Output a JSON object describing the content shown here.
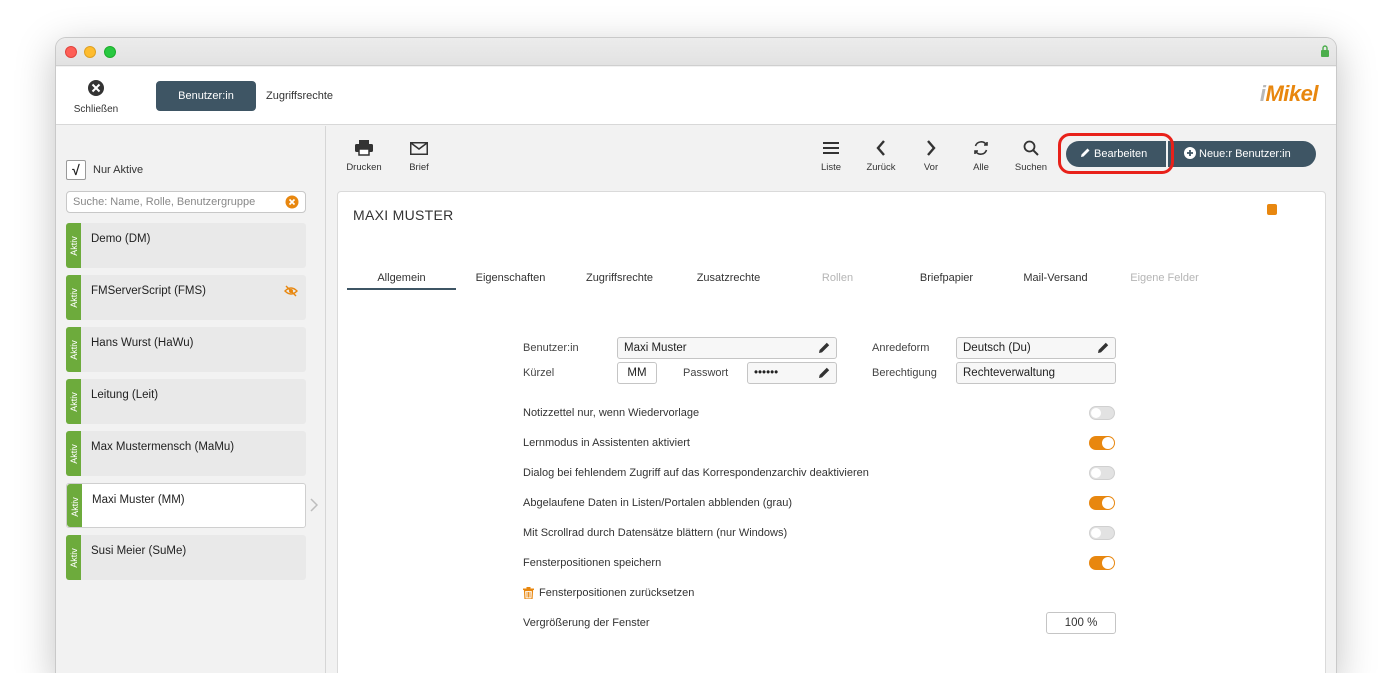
{
  "header": {
    "close_label": "Schließen",
    "tab_active": "Benutzer:in",
    "tab_rights": "Zugriffsrechte",
    "logo_i": "i",
    "logo_rest": "Mikel"
  },
  "sidebar": {
    "only_active_label": "Nur Aktive",
    "only_active_checked": true,
    "search_placeholder": "Suche: Name, Rolle, Benutzergruppe",
    "items": [
      {
        "status": "Aktiv",
        "name": "Demo (DM)"
      },
      {
        "status": "Aktiv",
        "name": "FMServerScript (FMS)"
      },
      {
        "status": "Aktiv",
        "name": "Hans Wurst (HaWu)"
      },
      {
        "status": "Aktiv",
        "name": "Leitung (Leit)"
      },
      {
        "status": "Aktiv",
        "name": "Max Mustermensch (MaMu)"
      },
      {
        "status": "Aktiv",
        "name": "Maxi Muster (MM)"
      },
      {
        "status": "Aktiv",
        "name": "Susi Meier (SuMe)"
      }
    ]
  },
  "toolbar": {
    "print": "Drucken",
    "letter": "Brief",
    "list": "Liste",
    "back": "Zurück",
    "forward": "Vor",
    "all": "Alle",
    "search": "Suchen",
    "edit": "Bearbeiten",
    "new_user": "Neue:r Benutzer:in"
  },
  "record": {
    "title": "MAXI MUSTER",
    "tabs": [
      {
        "label": "Allgemein",
        "active": true
      },
      {
        "label": "Eigenschaften"
      },
      {
        "label": "Zugriffsrechte"
      },
      {
        "label": "Zusatzrechte"
      },
      {
        "label": "Rollen",
        "disabled": true
      },
      {
        "label": "Briefpapier"
      },
      {
        "label": "Mail-Versand"
      },
      {
        "label": "Eigene Felder",
        "disabled": true
      }
    ],
    "fields": {
      "user_label": "Benutzer:in",
      "user_value": "Maxi Muster",
      "salutation_label": "Anredeform",
      "salutation_value": "Deutsch (Du)",
      "short_label": "Kürzel",
      "short_value": "MM",
      "password_label": "Passwort",
      "password_value": "••••••",
      "permission_label": "Berechtigung",
      "permission_value": "Rechteverwaltung"
    },
    "options": [
      {
        "label": "Notizzettel nur, wenn Wiedervorlage",
        "on": false
      },
      {
        "label": "Lernmodus in Assistenten aktiviert",
        "on": true
      },
      {
        "label": "Dialog bei fehlendem Zugriff auf das Korrespondenzarchiv deaktivieren",
        "on": false
      },
      {
        "label": "Abgelaufene Daten in Listen/Portalen abblenden (grau)",
        "on": true
      },
      {
        "label": "Mit Scrollrad durch Datensätze blättern (nur Windows)",
        "on": false
      },
      {
        "label": "Fensterpositionen speichern",
        "on": true
      }
    ],
    "reset_label": "Fensterpositionen zurücksetzen",
    "zoom_label": "Vergrößerung der Fenster",
    "zoom_value": "100 %"
  },
  "colors": {
    "accent": "#e8870f",
    "primary": "#3e5564",
    "status_active": "#6dab3c",
    "highlight": "#e8211a"
  }
}
